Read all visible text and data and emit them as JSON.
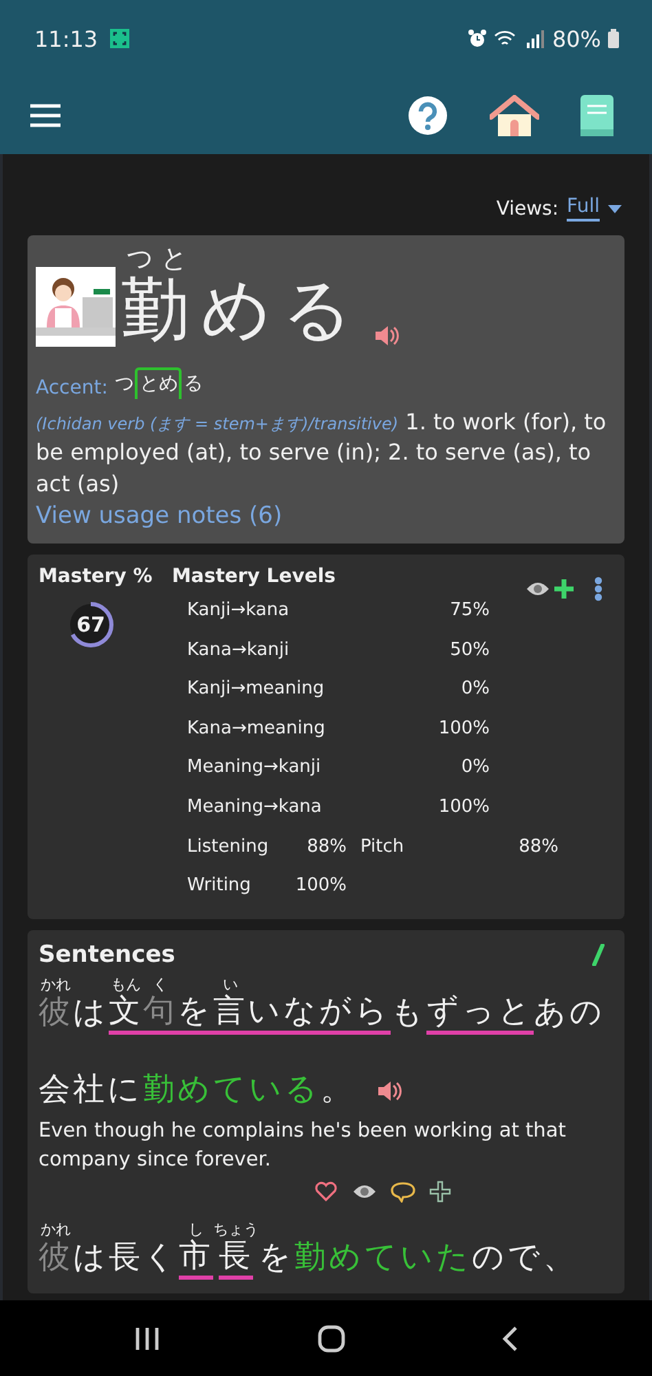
{
  "status_bar": {
    "time": "11:13",
    "battery": "80%"
  },
  "views": {
    "label": "Views:",
    "value": "Full"
  },
  "word": {
    "segments": [
      {
        "text": "勤",
        "ruby": "つと"
      },
      {
        "text": "める"
      }
    ],
    "accent": {
      "label": "Accent:",
      "morae": [
        {
          "text": "つ",
          "high": false
        },
        {
          "text": "とめ",
          "high": true
        },
        {
          "text": "る",
          "high": false
        }
      ]
    },
    "tags": "(Ichidan verb (ます = stem+ます)/transitive)",
    "definition": "1. to work (for), to be employed (at), to serve (in); 2. to serve (as), to act (as)",
    "usage_link": "View usage notes (6)"
  },
  "mastery": {
    "title": "Mastery %",
    "value": "67",
    "level": 0.67,
    "levels_title": "Mastery Levels",
    "rows": [
      {
        "label": "Kanji→kana",
        "value": "75%"
      },
      {
        "label": "Kana→kanji",
        "value": "50%"
      },
      {
        "label": "Kanji→meaning",
        "value": "0%"
      },
      {
        "label": "Kana→meaning",
        "value": "100%"
      },
      {
        "label": "Meaning→kanji",
        "value": "0%"
      },
      {
        "label": "Meaning→kana",
        "value": "100%"
      }
    ],
    "skills": [
      [
        {
          "label": "Listening",
          "value": "88%"
        },
        {
          "label": "Pitch",
          "value": "88%"
        }
      ],
      [
        {
          "label": "Writing",
          "value": "100%"
        }
      ]
    ]
  },
  "sentences": {
    "title": "Sentences",
    "items": [
      {
        "segments": [
          {
            "text": "彼",
            "ruby": "かれ",
            "kind": "grey",
            "underline": false
          },
          {
            "text": "は",
            "kind": "plain",
            "underline": false
          },
          {
            "text": "文",
            "ruby": "もん",
            "kind": "plain",
            "underline": true
          },
          {
            "text": "句",
            "ruby": "く",
            "kind": "grey",
            "underline": true
          },
          {
            "text": "を",
            "kind": "plain",
            "underline": true
          },
          {
            "text": "言",
            "ruby": "い",
            "kind": "plain",
            "underline": true
          },
          {
            "text": "いながら",
            "kind": "plain",
            "underline": true
          },
          {
            "text": "も",
            "kind": "plain",
            "underline": false
          },
          {
            "text": "ずっと",
            "kind": "plain",
            "underline": true
          },
          {
            "text": "あの",
            "kind": "plain",
            "underline": false
          },
          {
            "text": "会社",
            "kind": "plain",
            "underline": false
          },
          {
            "text": "に",
            "kind": "plain",
            "underline": false
          },
          {
            "text": "勤めている",
            "kind": "target",
            "underline": false
          },
          {
            "text": "。",
            "kind": "plain",
            "underline": false
          }
        ],
        "audio": true,
        "translation": "Even though he complains he's been working at that company since forever."
      },
      {
        "segments": [
          {
            "text": "彼",
            "ruby": "かれ",
            "kind": "grey",
            "underline": false
          },
          {
            "text": "は",
            "kind": "plain",
            "underline": false
          },
          {
            "text": "長く",
            "kind": "plain",
            "underline": false
          },
          {
            "text": "市",
            "ruby": "し",
            "kind": "plain",
            "underline": true
          },
          {
            "text": "長",
            "ruby": "ちょう",
            "kind": "plain",
            "underline": true
          },
          {
            "text": "を",
            "kind": "plain",
            "underline": false
          },
          {
            "text": "勤めていた",
            "kind": "target",
            "underline": false
          },
          {
            "text": "ので、",
            "kind": "plain",
            "underline": false
          }
        ],
        "audio": false
      }
    ]
  }
}
